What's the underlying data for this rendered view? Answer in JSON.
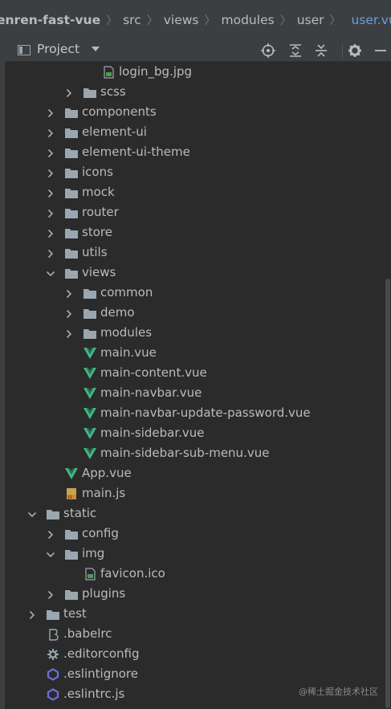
{
  "breadcrumb": {
    "items": [
      "enren-fast-vue",
      "src",
      "views",
      "modules",
      "user"
    ],
    "current": "user.vue"
  },
  "toolbar": {
    "title": "Project",
    "buttons": [
      "locate-icon",
      "expand-all-icon",
      "collapse-all-icon",
      "gear-icon",
      "hide-icon"
    ]
  },
  "tree": {
    "rows": [
      {
        "label": "login_bg.jpg",
        "icon": "image-file",
        "arrow": "none",
        "depth": 4
      },
      {
        "label": "scss",
        "icon": "folder",
        "arrow": "right",
        "depth": 3
      },
      {
        "label": "components",
        "icon": "folder",
        "arrow": "right",
        "depth": 2
      },
      {
        "label": "element-ui",
        "icon": "folder",
        "arrow": "right",
        "depth": 2
      },
      {
        "label": "element-ui-theme",
        "icon": "folder",
        "arrow": "right",
        "depth": 2
      },
      {
        "label": "icons",
        "icon": "folder",
        "arrow": "right",
        "depth": 2
      },
      {
        "label": "mock",
        "icon": "folder",
        "arrow": "right",
        "depth": 2
      },
      {
        "label": "router",
        "icon": "folder",
        "arrow": "right",
        "depth": 2
      },
      {
        "label": "store",
        "icon": "folder",
        "arrow": "right",
        "depth": 2
      },
      {
        "label": "utils",
        "icon": "folder",
        "arrow": "right",
        "depth": 2
      },
      {
        "label": "views",
        "icon": "folder",
        "arrow": "down",
        "depth": 2
      },
      {
        "label": "common",
        "icon": "folder",
        "arrow": "right",
        "depth": 3
      },
      {
        "label": "demo",
        "icon": "folder",
        "arrow": "right",
        "depth": 3
      },
      {
        "label": "modules",
        "icon": "folder",
        "arrow": "right",
        "depth": 3
      },
      {
        "label": "main.vue",
        "icon": "vue",
        "arrow": "none",
        "depth": 3
      },
      {
        "label": "main-content.vue",
        "icon": "vue",
        "arrow": "none",
        "depth": 3
      },
      {
        "label": "main-navbar.vue",
        "icon": "vue",
        "arrow": "none",
        "depth": 3
      },
      {
        "label": "main-navbar-update-password.vue",
        "icon": "vue",
        "arrow": "none",
        "depth": 3
      },
      {
        "label": "main-sidebar.vue",
        "icon": "vue",
        "arrow": "none",
        "depth": 3
      },
      {
        "label": "main-sidebar-sub-menu.vue",
        "icon": "vue",
        "arrow": "none",
        "depth": 3
      },
      {
        "label": "App.vue",
        "icon": "vue",
        "arrow": "none",
        "depth": 2
      },
      {
        "label": "main.js",
        "icon": "js",
        "arrow": "none",
        "depth": 2
      },
      {
        "label": "static",
        "icon": "folder",
        "arrow": "down",
        "depth": 1
      },
      {
        "label": "config",
        "icon": "folder",
        "arrow": "right",
        "depth": 2
      },
      {
        "label": "img",
        "icon": "folder",
        "arrow": "down",
        "depth": 2
      },
      {
        "label": "favicon.ico",
        "icon": "image-file",
        "arrow": "none",
        "depth": 3
      },
      {
        "label": "plugins",
        "icon": "folder",
        "arrow": "right",
        "depth": 2
      },
      {
        "label": "test",
        "icon": "folder",
        "arrow": "right",
        "depth": 1
      },
      {
        "label": ".babelrc",
        "icon": "babel",
        "arrow": "none",
        "depth": 1
      },
      {
        "label": ".editorconfig",
        "icon": "gear",
        "arrow": "none",
        "depth": 1
      },
      {
        "label": ".eslintignore",
        "icon": "eslint",
        "arrow": "none",
        "depth": 1
      },
      {
        "label": ".eslintrc.js",
        "icon": "eslint",
        "arrow": "none",
        "depth": 1
      }
    ]
  },
  "watermark": "@稀土掘金技术社区",
  "colors": {
    "background": "#2b2b2b",
    "toolbar": "#3c3f41",
    "text": "#bbbbbb",
    "folder": "#9aa7b0",
    "vue_green": "#41b883",
    "link_blue": "#6b9fd8"
  }
}
